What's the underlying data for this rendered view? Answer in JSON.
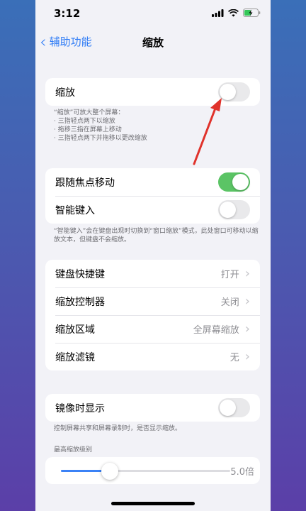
{
  "status_bar": {
    "time": "3:12"
  },
  "nav": {
    "back_label": "辅助功能",
    "title": "缩放"
  },
  "zoom": {
    "label": "缩放",
    "on": false
  },
  "zoom_footer": [
    "“缩放”可放大整个屏幕：",
    "·  三指轻点两下以缩放",
    "·  拖移三指在屏幕上移动",
    "·  三指轻点两下并拖移以更改缩放"
  ],
  "focus_group": {
    "follow_focus": {
      "label": "跟随焦点移动",
      "on": true
    },
    "smart_typing": {
      "label": "智能键入",
      "on": false
    }
  },
  "smart_typing_footer": "“智能键入”会在键盘出现时切换到“窗口缩放”模式，此处窗口可移动以缩放文本，但键盘不会缩放。",
  "settings": {
    "keyboard_shortcuts": {
      "label": "键盘快捷键",
      "value": "打开"
    },
    "zoom_controller": {
      "label": "缩放控制器",
      "value": "关闭"
    },
    "zoom_region": {
      "label": "缩放区域",
      "value": "全屏幕缩放"
    },
    "zoom_filter": {
      "label": "缩放滤镜",
      "value": "无"
    }
  },
  "mirror": {
    "label": "镜像时显示",
    "on": false
  },
  "mirror_footer": "控制屏幕共享和屏幕录制时，是否显示缩放。",
  "max_zoom": {
    "caption": "最高缩放级别",
    "value_label": "5.0倍",
    "level": 0.29
  },
  "colors": {
    "accent": "#2f7cf6",
    "toggle_on": "#5bc465",
    "arrow": "#e0322b"
  }
}
